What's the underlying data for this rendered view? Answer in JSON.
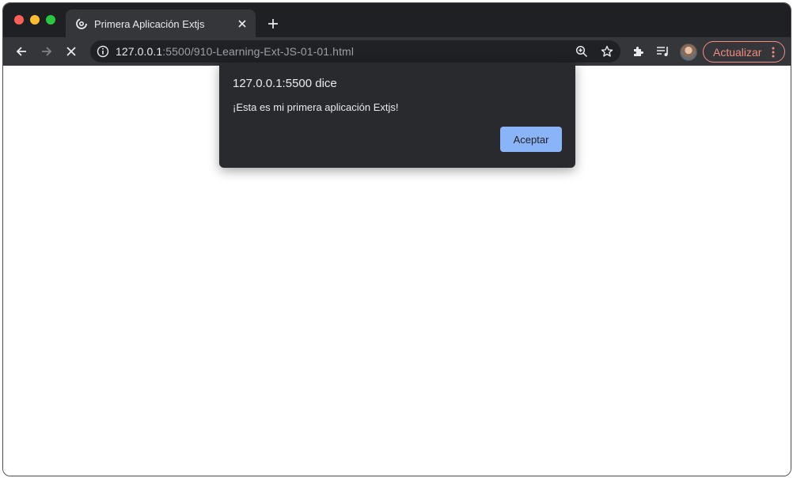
{
  "browser": {
    "tab": {
      "title": "Primera Aplicación Extjs",
      "favicon": "loading-spinner-icon"
    },
    "new_tab_icon": "plus-icon",
    "address_bar": {
      "url_host": "127.0.0.1",
      "url_rest": ":5500/910-Learning-Ext-JS-01-01.html"
    },
    "update_button": {
      "label": "Actualizar"
    }
  },
  "dialog": {
    "title": "127.0.0.1:5500 dice",
    "message": "¡Esta es mi primera aplicación Extjs!",
    "ok_label": "Aceptar"
  },
  "colors": {
    "accent_button": "#8ab4f8",
    "update_button": "#f28b82",
    "toolbar": "#35363a",
    "tabstrip": "#1f2023"
  }
}
